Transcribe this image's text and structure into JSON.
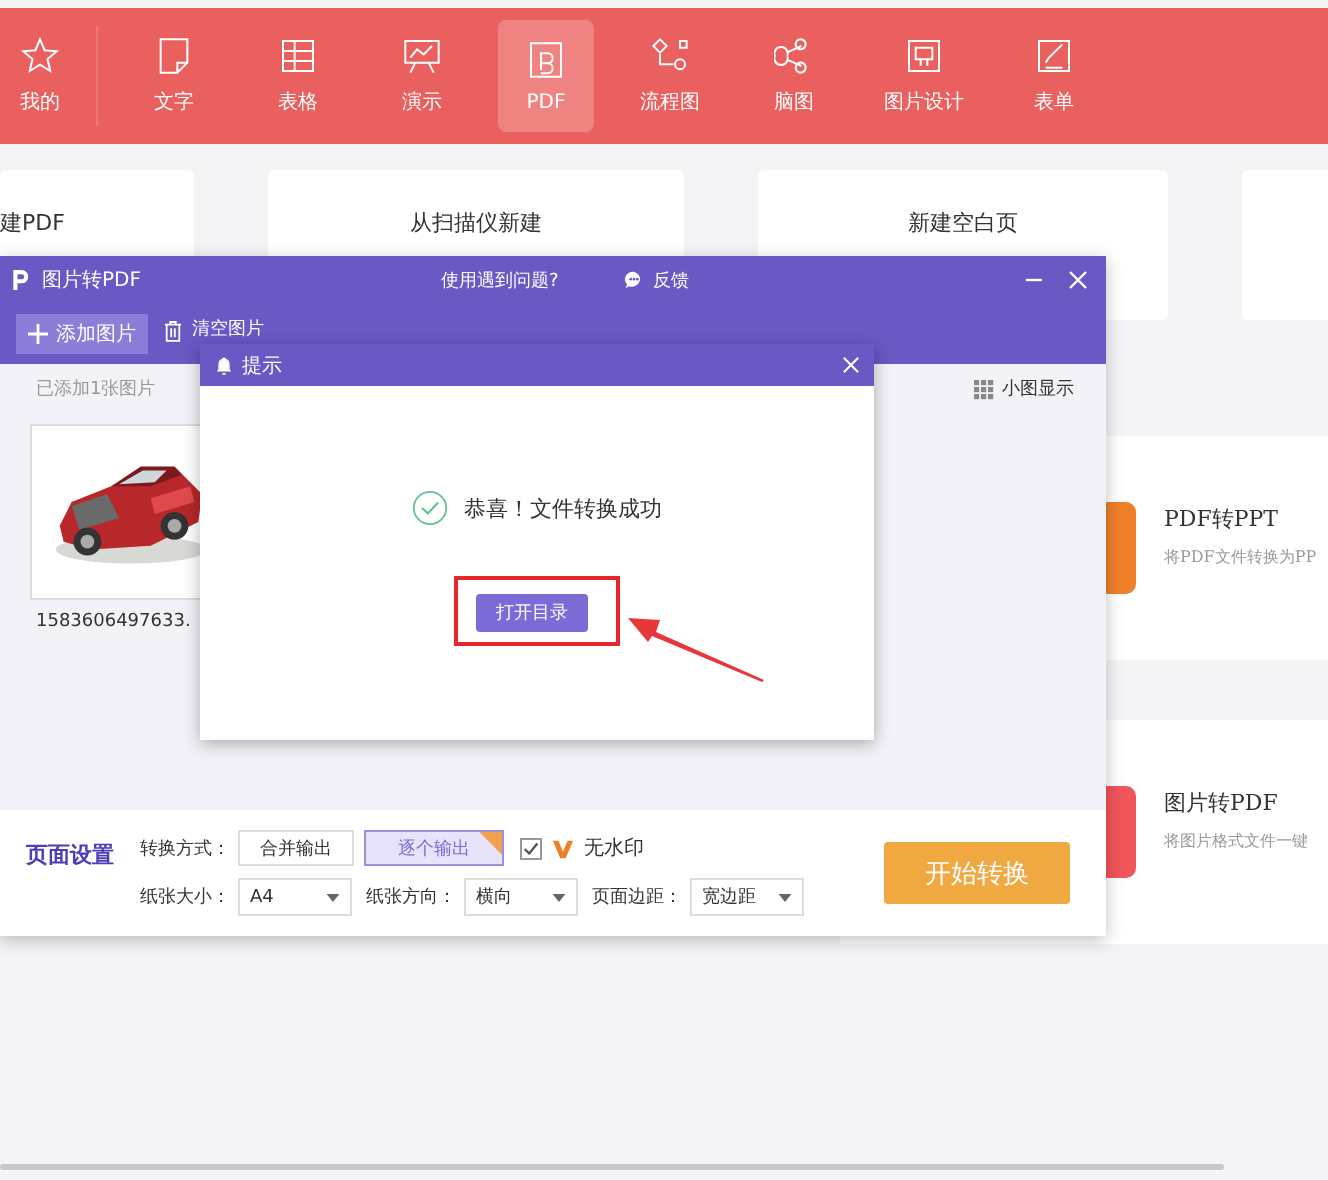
{
  "top_nav": {
    "items": [
      {
        "label": "我的",
        "selected": false
      },
      {
        "label": "文字",
        "selected": false
      },
      {
        "label": "表格",
        "selected": false
      },
      {
        "label": "演示",
        "selected": false
      },
      {
        "label": "PDF",
        "selected": true
      },
      {
        "label": "流程图",
        "selected": false
      },
      {
        "label": "脑图",
        "selected": false
      },
      {
        "label": "图片设计",
        "selected": false
      },
      {
        "label": "表单",
        "selected": false
      }
    ]
  },
  "cards": [
    {
      "title": "建PDF"
    },
    {
      "title": "从扫描仪新建"
    },
    {
      "title": "新建空白页"
    }
  ],
  "features": [
    {
      "title": "PDF转PPT",
      "description": "将PDF文件转换为PP",
      "color": "#f07f2a"
    },
    {
      "title": "图片转PDF",
      "description": "将图片格式文件一键",
      "color": "#f0555a"
    }
  ],
  "window": {
    "title": "图片转PDF",
    "help_link": "使用遇到问题?",
    "feedback": "反馈",
    "toolbar": {
      "add": "添加图片",
      "clear": "清空图片"
    },
    "count": "已添加1张图片",
    "view_toggle": "小图显示",
    "thumbnails": [
      {
        "kind": "picture",
        "filename": "1583606497633."
      }
    ],
    "settings": {
      "heading": "页面设置",
      "mode_label": "转换方式：",
      "modes": [
        {
          "label": "合并输出",
          "selected": false
        },
        {
          "label": "逐个输出",
          "selected": true
        }
      ],
      "watermark": {
        "label": "无水印",
        "checked": true
      },
      "selects": [
        {
          "label": "纸张大小：",
          "value": "A4"
        },
        {
          "label": "纸张方向：",
          "value": "横向"
        },
        {
          "label": "页面边距：",
          "value": "宽边距"
        }
      ],
      "start_button": "开始转换"
    }
  },
  "dialog": {
    "title": "提示",
    "message": "恭喜！文件转换成功",
    "button": "打开目录"
  }
}
